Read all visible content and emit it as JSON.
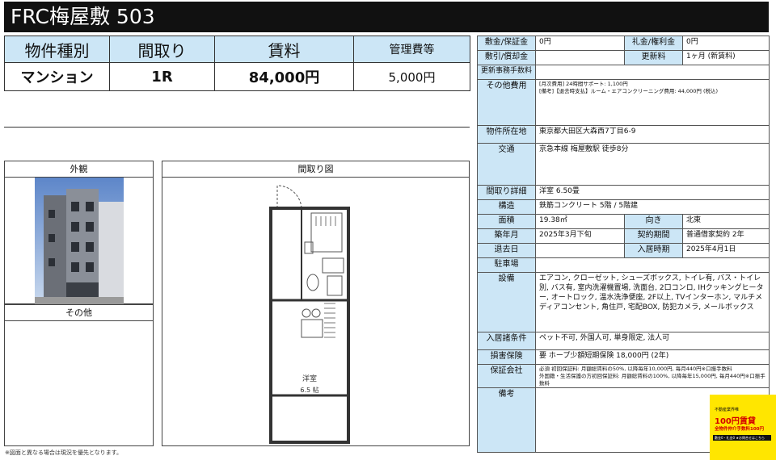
{
  "title": "FRC梅屋敷 503",
  "summary": {
    "headers": [
      "物件種別",
      "間取り",
      "賃料",
      "管理費等"
    ],
    "values": [
      "マンション",
      "1R",
      "84,000円",
      "5,000円"
    ]
  },
  "panels": {
    "exterior_label": "外観",
    "other_label": "その他",
    "floorplan_label": "間取り図",
    "room_name": "洋室",
    "room_size": "6.5 帖"
  },
  "footnote": "※図面と異なる場合は現況を優先となります。",
  "details": {
    "deposit_label": "敷金/保証金",
    "deposit_value": "0円",
    "key_money_label": "礼金/権利金",
    "key_money_value": "0円",
    "amortization_label": "敷引/償却金",
    "amortization_value": "",
    "renewal_label": "更新料",
    "renewal_value": "1ヶ月 (新賃料)",
    "renewal_admin_label": "更新事務手数料",
    "renewal_admin_value": "",
    "other_costs_label": "その他費用",
    "other_costs_value": "[月次費用] 24時間サポート: 1,100円\n[備考]【退去時支払】ルーム・エアコンクリーニング費用: 44,000円 (税込)",
    "address_label": "物件所在地",
    "address_value": "東京都大田区大森西7丁目6-9",
    "transport_label": "交通",
    "transport_value": "京急本線 梅屋敷駅 徒歩8分",
    "layout_label": "間取り詳細",
    "layout_value": "洋室 6.50畳",
    "structure_label": "構造",
    "structure_value": "鉄筋コンクリート 5階 / 5階建",
    "area_label": "面積",
    "area_value": "19.38㎡",
    "direction_label": "向き",
    "direction_value": "北東",
    "built_label": "築年月",
    "built_value": "2025年3月下旬",
    "contract_label": "契約期間",
    "contract_value": "普通借家契約 2年",
    "vacate_label": "退去日",
    "vacate_value": "",
    "movein_label": "入居時期",
    "movein_value": "2025年4月1日",
    "parking_label": "駐車場",
    "parking_value": "",
    "equipment_label": "設備",
    "equipment_value": "エアコン, クローゼット, シューズボックス, トイレ有, バス・トイレ別, バス有, 室内洗濯機置場, 洗面台, 2口コンロ, IHクッキングヒーター, オートロック, 温水洗浄便座, 2F以上, TVインターホン, マルチメディアコンセント, 角住戸, 宅配BOX, 防犯カメラ, メールボックス",
    "conditions_label": "入居諸条件",
    "conditions_value": "ペット不可, 外国人可, 単身限定, 法人可",
    "insurance_label": "損害保険",
    "insurance_value": "要 ホープ少額短期保険 18,000円 (2年)",
    "guarantor_label": "保証会社",
    "guarantor_value": "必須 初回保証料: 月額総賃料の50%, 以降毎年10,000円, 毎月440円※口振手数料\n外国籍・生活保護の方初回保証料: 月額総賃料の100%, 以降毎年15,000円, 毎月440円※口振手数料",
    "remarks_label": "備考",
    "remarks_value": ""
  },
  "ad_badge": {
    "line1": "不動産業界唯",
    "line2": "100円賃貸",
    "line3": "全物件仲介手数料100円",
    "line4": "敷金0・礼金0 ★お問合せはこちら"
  },
  "colors": {
    "header_bg": "#cce6f6",
    "title_bg": "#111111",
    "badge_bg": "#ffe600",
    "badge_text": "#d40000"
  }
}
